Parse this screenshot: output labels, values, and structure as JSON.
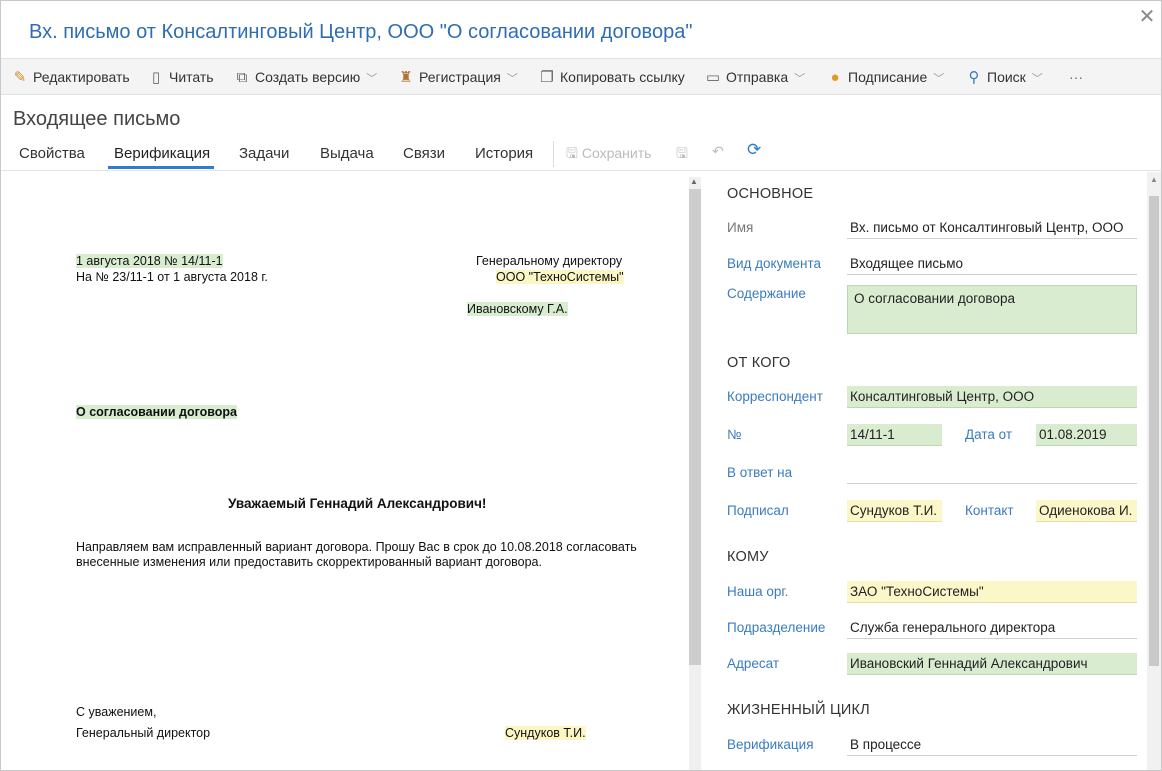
{
  "window": {
    "title": "Вх. письмо от Консалтинговый Центр, ООО \"О согласовании договора\"",
    "close_glyph": "✕"
  },
  "toolbar": {
    "edit": "Редактировать",
    "read": "Читать",
    "create_version": "Создать версию",
    "registration": "Регистрация",
    "copy_link": "Копировать ссылку",
    "send": "Отправка",
    "sign": "Подписание",
    "search": "Поиск",
    "more": "···"
  },
  "page_title": "Входящее письмо",
  "tabs": {
    "properties": "Свойства",
    "verification": "Верификация",
    "tasks": "Задачи",
    "issue": "Выдача",
    "links": "Связи",
    "history": "История",
    "save": "Сохранить"
  },
  "letter": {
    "date_num": "1 августа 2018 № 14/11-1",
    "reply_to": "На № 23/11-1 от 1 августа 2018 г.",
    "addressee_line1": "Генеральному директору",
    "addressee_line2": "ООО \"ТехноСистемы\"",
    "addressee_name": "Ивановскому Г.А.",
    "subject": "О согласовании договора",
    "greeting": "Уважаемый Геннадий Александрович!",
    "body_line1": "Направляем вам исправленный вариант договора. Прошу Вас в срок до 10.08.2018 согласовать",
    "body_line2": "внесенные изменения или предоставить скорректированный вариант договора.",
    "closing": "С уважением,",
    "signer_title": "Генеральный директор",
    "signer_name": "Сундуков Т.И."
  },
  "panel": {
    "main": {
      "heading": "ОСНОВНОЕ",
      "name_label": "Имя",
      "name_value": "Вх. письмо от Консалтинговый Центр, ООО",
      "doc_type_label": "Вид документа",
      "doc_type_value": "Входящее письмо",
      "content_label": "Содержание",
      "content_value": "О согласовании договора"
    },
    "from": {
      "heading": "ОТ КОГО",
      "correspondent_label": "Корреспондент",
      "correspondent_value": "Консалтинговый Центр, ООО",
      "number_label": "№",
      "number_value": "14/11-1",
      "date_label": "Дата от",
      "date_value": "01.08.2019",
      "reply_label": "В ответ на",
      "reply_value": "",
      "signed_label": "Подписал",
      "signed_value": "Сундуков Т.И.",
      "contact_label": "Контакт",
      "contact_value": "Одиенокова И."
    },
    "to": {
      "heading": "КОМУ",
      "org_label": "Наша орг.",
      "org_value": "ЗАО \"ТехноСистемы\"",
      "dept_label": "Подразделение",
      "dept_value": "Служба генерального директора",
      "addressee_label": "Адресат",
      "addressee_value": "Ивановский Геннадий Александрович"
    },
    "lifecycle": {
      "heading": "ЖИЗНЕННЫЙ ЦИКЛ",
      "verification_label": "Верификация",
      "verification_value": "В процессе"
    }
  },
  "colors": {
    "accent": "#2e7ccc",
    "title": "#2e6db4",
    "highlight_green": "#d9ecd0",
    "highlight_yellow": "#fcf7c9"
  }
}
